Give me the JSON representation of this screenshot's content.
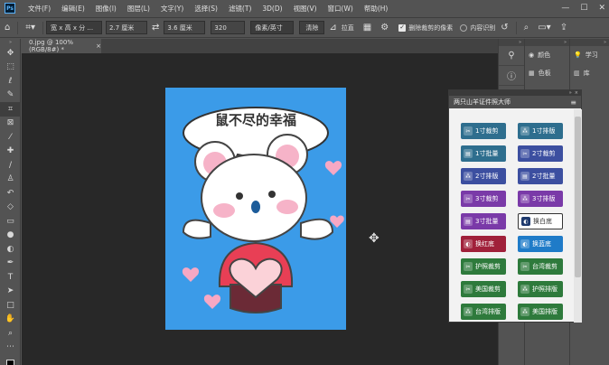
{
  "app": {
    "logo": "Ps"
  },
  "menu": [
    "文件(F)",
    "编辑(E)",
    "图像(I)",
    "图层(L)",
    "文字(Y)",
    "选择(S)",
    "滤镜(T)",
    "3D(D)",
    "视图(V)",
    "窗口(W)",
    "帮助(H)"
  ],
  "window_controls": {
    "minimize": "—",
    "maximize": "☐",
    "close": "✕"
  },
  "options": {
    "ratio_value": "宽 x 高 x 分 ...",
    "width_value": "2.7 厘米",
    "height_value": "3.6 厘米",
    "resolution_value": "320",
    "unit_value": "像素/英寸",
    "clear_label": "清除",
    "straighten_label": "拉直",
    "delete_cropped_label": "删除裁剪的像素",
    "content_aware_label": "内容识别"
  },
  "document": {
    "tab_title": "0.jpg @ 100%(RGB/8#) *",
    "close": "×",
    "bubble_text": "鼠不尽的幸福"
  },
  "panels": {
    "col1_icons": [
      "paint-icon",
      "info-icon"
    ],
    "color_label": "颜色",
    "swatches_label": "色板",
    "learn_label": "学习",
    "library_label": "库"
  },
  "plugin": {
    "title": "两只山羊证件照大师",
    "buttons": [
      {
        "label": "1寸裁剪",
        "color": "#2e6e8e"
      },
      {
        "label": "1寸排版",
        "color": "#2e6e8e"
      },
      {
        "label": "1寸批量",
        "color": "#2e6e8e"
      },
      {
        "label": "2寸裁剪",
        "color": "#3c4fa0"
      },
      {
        "label": "2寸排版",
        "color": "#3c4fa0"
      },
      {
        "label": "2寸批量",
        "color": "#3c4fa0"
      },
      {
        "label": "3寸裁剪",
        "color": "#7a3aa8"
      },
      {
        "label": "3寸排版",
        "color": "#7a3aa8"
      },
      {
        "label": "3寸批量",
        "color": "#7a3aa8"
      },
      {
        "label": "换白底",
        "color": "#ffffff"
      },
      {
        "label": "换红底",
        "color": "#a0203a"
      },
      {
        "label": "换蓝底",
        "color": "#1f7bc8"
      },
      {
        "label": "护照裁剪",
        "color": "#2e7a3c"
      },
      {
        "label": "台湾裁剪",
        "color": "#2e7a3c"
      },
      {
        "label": "美国裁剪",
        "color": "#2e7a3c"
      },
      {
        "label": "护照排版",
        "color": "#2e7a3c"
      },
      {
        "label": "台湾排版",
        "color": "#2e7a3c"
      },
      {
        "label": "美国排版",
        "color": "#2e7a3c"
      }
    ]
  }
}
